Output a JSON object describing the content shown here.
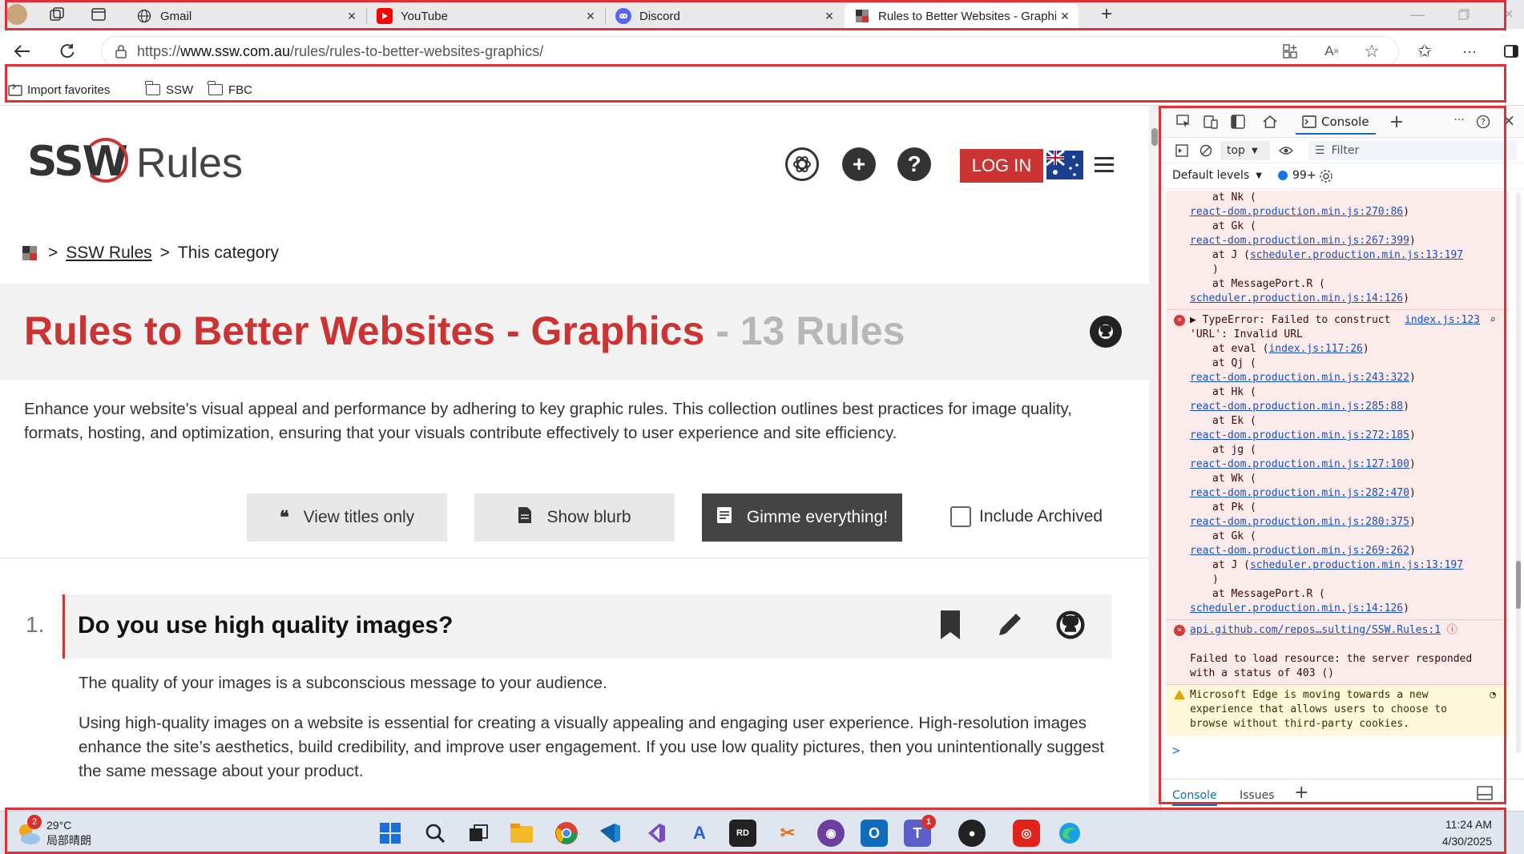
{
  "tabs": [
    {
      "label": "Gmail",
      "icon": "globe-icon"
    },
    {
      "label": "YouTube",
      "icon": "youtube-icon"
    },
    {
      "label": "Discord",
      "icon": "discord-icon"
    },
    {
      "label": "Rules to Better Websites - Graphi",
      "icon": "ssw-favicon"
    }
  ],
  "address": {
    "prefix": "https://",
    "host": "www.ssw.com.au",
    "path": "/rules/rules-to-better-websites-graphics/"
  },
  "favorites": {
    "import": "Import favorites",
    "folders": [
      "SSW",
      "FBC"
    ]
  },
  "site": {
    "logo_ssw": "SSW",
    "logo_rules": "Rules",
    "login": "LOG IN",
    "breadcrumb": {
      "sep": ">",
      "root": "SSW Rules",
      "current": "This category"
    },
    "title": "Rules to Better Websites - Graphics",
    "title_count": "- 13 Rules",
    "intro": "Enhance your website's visual appeal and performance by adhering to key graphic rules. This collection outlines best practices for image quality, formats, hosting, and optimization, ensuring that your visuals contribute effectively to user experience and site efficiency.",
    "view_buttons": [
      "View titles only",
      "Show blurb",
      "Gimme everything!"
    ],
    "include_archived": "Include Archived",
    "rule": {
      "number": "1.",
      "title": "Do you use high quality images?",
      "p1": "The quality of your images is a subconscious message to your audience.",
      "p2": "Using high-quality images on a website is essential for creating a visually appealing and engaging user experience. High-resolution images enhance the site’s aesthetics, build credibility, and improve user engagement. If you use low quality pictures, then you unintentionally suggest the same message about your product."
    }
  },
  "devtools": {
    "console_tab": "Console",
    "context": "top",
    "filter": "Filter",
    "levels": "Default levels",
    "count": "99+",
    "stack1": [
      {
        "text": "at Nk (",
        "link": ""
      },
      {
        "text": "",
        "link": "react-dom.production.min.js:270:86",
        "suffix": ")"
      },
      {
        "text": "at Gk (",
        "link": ""
      },
      {
        "text": "",
        "link": "react-dom.production.min.js:267:399",
        "suffix": ")"
      },
      {
        "text": "at J (",
        "link": "scheduler.production.min.js:13:197",
        "suffix": ""
      },
      {
        "text": ")",
        "link": ""
      },
      {
        "text": "at MessagePort.R (",
        "link": ""
      },
      {
        "text": "",
        "link": "scheduler.production.min.js:14:126",
        "suffix": ")"
      }
    ],
    "error2_head": "TypeError: Failed to construct 'URL': Invalid URL",
    "error2_link": "index.js:123",
    "stack2": [
      {
        "text": "at eval (",
        "link": "index.js:117:26",
        "suffix": ")"
      },
      {
        "text": "at Qj (",
        "link": ""
      },
      {
        "text": "",
        "link": "react-dom.production.min.js:243:322",
        "suffix": ")"
      },
      {
        "text": "at Hk (",
        "link": ""
      },
      {
        "text": "",
        "link": "react-dom.production.min.js:285:88",
        "suffix": ")"
      },
      {
        "text": "at Ek (",
        "link": ""
      },
      {
        "text": "",
        "link": "react-dom.production.min.js:272:185",
        "suffix": ")"
      },
      {
        "text": "at jg (",
        "link": ""
      },
      {
        "text": "",
        "link": "react-dom.production.min.js:127:100",
        "suffix": ")"
      },
      {
        "text": "at Wk (",
        "link": ""
      },
      {
        "text": "",
        "link": "react-dom.production.min.js:282:470",
        "suffix": ")"
      },
      {
        "text": "at Pk (",
        "link": ""
      },
      {
        "text": "",
        "link": "react-dom.production.min.js:280:375",
        "suffix": ")"
      },
      {
        "text": "at Gk (",
        "link": ""
      },
      {
        "text": "",
        "link": "react-dom.production.min.js:269:262",
        "suffix": ")"
      },
      {
        "text": "at J (",
        "link": "scheduler.production.min.js:13:197",
        "suffix": ""
      },
      {
        "text": ")",
        "link": ""
      },
      {
        "text": "at MessagePort.R (",
        "link": ""
      },
      {
        "text": "",
        "link": "scheduler.production.min.js:14:126",
        "suffix": ")"
      }
    ],
    "error3_link": "api.github.com/repos…sulting/SSW.Rules:1",
    "error3_text": "Failed to load resource: the server responded with a status of 403 ()",
    "warn_text": "Microsoft Edge is moving towards a new experience that allows users to choose to browse without third-party cookies.",
    "prompt": ">",
    "bottom_tabs": [
      "Console",
      "Issues"
    ]
  },
  "taskbar": {
    "weather_temp": "29°C",
    "weather_desc": "局部晴朗",
    "weather_badge": "2",
    "teams_badge": "1",
    "time": "11:24 AM",
    "date": "4/30/2025"
  },
  "colors": {
    "brand": "#cc3333",
    "highlight_box": "#e0303a",
    "link": "#1a4fc0"
  }
}
